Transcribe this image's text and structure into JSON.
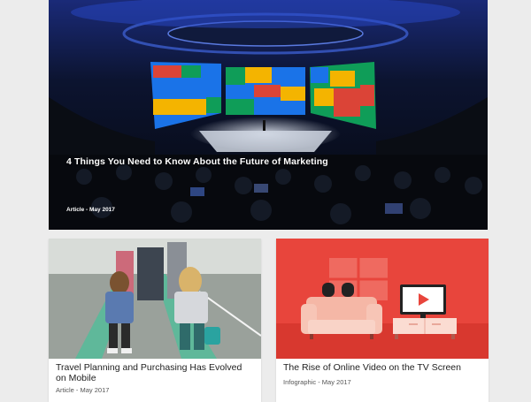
{
  "hero": {
    "title": "4 Things You Need to Know About the Future of Marketing",
    "meta": "Article - May 2017"
  },
  "cards": [
    {
      "title": "Travel Planning and Purchasing Has Evolved on Mobile",
      "meta": "Article - May 2017"
    },
    {
      "title": "The Rise of Online Video on the TV Screen",
      "meta": "Infographic - May 2017"
    }
  ],
  "colors": {
    "page_background": "#ececec",
    "infographic_red": "#e8453c",
    "google_blue": "#4285f4",
    "google_red": "#db4437",
    "google_yellow": "#f4b400",
    "google_green": "#0f9d58"
  }
}
